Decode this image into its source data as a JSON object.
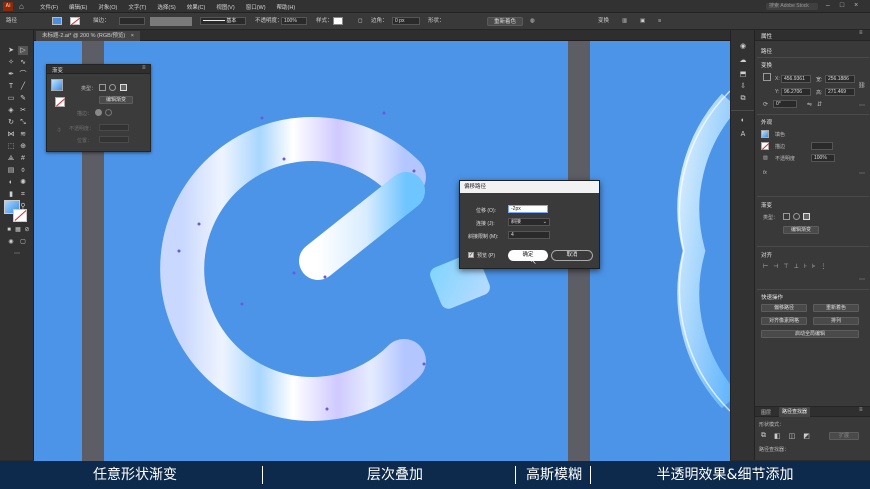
{
  "menubar": {
    "logo": "Ai",
    "items": [
      "文件(F)",
      "编辑(E)",
      "对象(O)",
      "文字(T)",
      "选择(S)",
      "效果(C)",
      "视图(V)",
      "窗口(W)",
      "帮助(H)"
    ],
    "right_search": "搜索 Adobe Stock"
  },
  "control_bar": {
    "mode_label": "路径",
    "stroke_label": "描边：",
    "stroke_style": "基本",
    "opacity_label": "不透明度：",
    "opacity_value": "100%",
    "style_label": "样式：",
    "corner_label": "边角：",
    "corner_value": "0 px",
    "shape_label": "形状：",
    "recolor_button": "重新着色",
    "transform_label": "变换"
  },
  "document": {
    "tab_title": "未标题-2.ai* @ 200 % (RGB/预览)",
    "tab_close": "×"
  },
  "gradient_panel": {
    "title": "渐变",
    "type_label": "类型：",
    "edit_button": "编辑渐变",
    "stroke_label": "描边：",
    "opacity_label": "不透明度：",
    "position_label": "位置："
  },
  "offset_dialog": {
    "title": "偏移路径",
    "offset_label": "位移 (O):",
    "offset_value": "-2px",
    "joins_label": "连接 (J):",
    "joins_value": "斜接",
    "miter_label": "斜接限制 (M):",
    "miter_value": "4",
    "preview_label": "预览 (P)",
    "ok_button": "确定",
    "cancel_button": "取消"
  },
  "properties_panel": {
    "tab_label": "属性",
    "section_path": "路径",
    "section_transform": "变换",
    "x_label": "X:",
    "x_value": "456.9361",
    "y_label": "Y:",
    "y_value": "96.2706",
    "w_label": "宽:",
    "w_value": "256.1886",
    "h_label": "高:",
    "h_value": "271.469",
    "angle_value": "0°",
    "section_appearance": "外观",
    "fill_label": "填色",
    "stroke_label": "描边",
    "opacity_label": "不透明度",
    "opacity_value": "100%",
    "fx_label": "fx",
    "section_gradient": "渐变",
    "grad_type_label": "类型：",
    "grad_edit_button": "编辑渐变",
    "section_align": "对齐",
    "section_quick": "快速操作",
    "btn_offset": "偏移路径",
    "btn_recolor": "重新着色",
    "btn_pixel": "对齐像素网格",
    "btn_arrange": "排列",
    "btn_global": "启动全局编辑",
    "bottom_tabs": [
      "图层",
      "路径查找器"
    ],
    "shape_mode_label": "形状模式：",
    "expand_button": "扩展",
    "pathfinder_label": "路径查找器："
  },
  "caption": {
    "seg1": "任意形状渐变",
    "seg2": "层次叠加",
    "seg3": "高斯模糊",
    "seg4": "半透明效果&细节添加"
  },
  "colors": {
    "canvas": "#4c94e8",
    "caption_bg": "#0d2a4d",
    "ui_dark": "#323232"
  }
}
